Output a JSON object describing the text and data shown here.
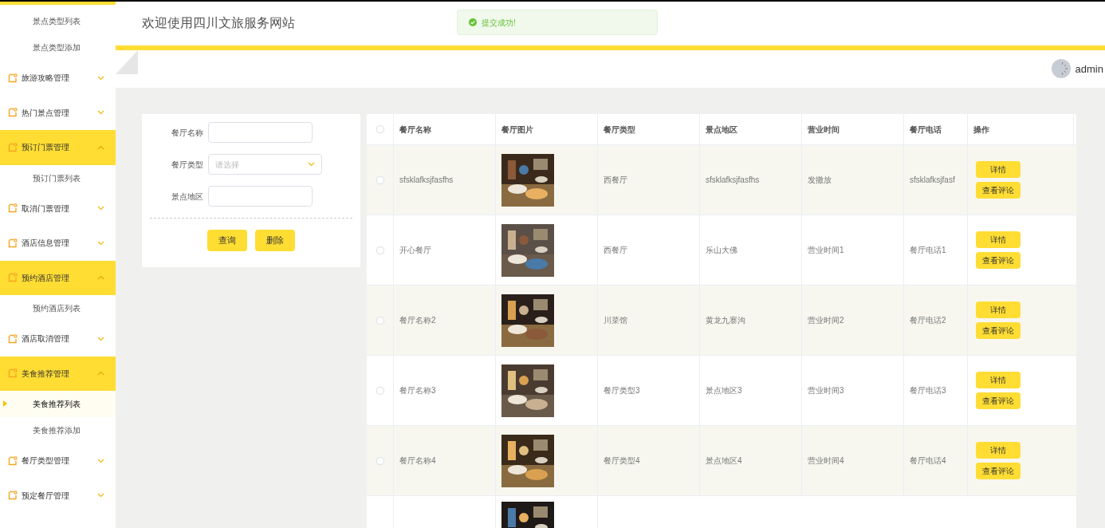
{
  "sidebar": {
    "items": [
      {
        "kind": "sub",
        "label": "景点类型列表",
        "selected": false
      },
      {
        "kind": "sub",
        "label": "景点类型添加",
        "selected": false
      },
      {
        "kind": "group",
        "label": "旅游攻略管理",
        "expanded": false
      },
      {
        "kind": "group",
        "label": "热门景点管理",
        "expanded": false
      },
      {
        "kind": "group",
        "label": "预订门票管理",
        "expanded": true
      },
      {
        "kind": "sub",
        "label": "预订门票列表",
        "selected": false
      },
      {
        "kind": "group",
        "label": "取消门票管理",
        "expanded": false
      },
      {
        "kind": "group",
        "label": "酒店信息管理",
        "expanded": false
      },
      {
        "kind": "group",
        "label": "预约酒店管理",
        "expanded": true
      },
      {
        "kind": "sub",
        "label": "预约酒店列表",
        "selected": false
      },
      {
        "kind": "group",
        "label": "酒店取消管理",
        "expanded": false
      },
      {
        "kind": "group",
        "label": "美食推荐管理",
        "expanded": true
      },
      {
        "kind": "sub",
        "label": "美食推荐列表",
        "selected": true
      },
      {
        "kind": "sub",
        "label": "美食推荐添加",
        "selected": false
      },
      {
        "kind": "group",
        "label": "餐厅类型管理",
        "expanded": false
      },
      {
        "kind": "group",
        "label": "预定餐厅管理",
        "expanded": false
      }
    ]
  },
  "header": {
    "title": "欢迎使用四川文旅服务网站",
    "user": "admin"
  },
  "toast": {
    "message": "提交成功!"
  },
  "search_form": {
    "fields": [
      {
        "kind": "input",
        "label": "餐厅名称"
      },
      {
        "kind": "select",
        "label": "餐厅类型",
        "placeholder": "请选择"
      },
      {
        "kind": "input",
        "label": "景点地区"
      }
    ],
    "buttons": [
      "查询",
      "删除"
    ]
  },
  "table": {
    "all_checked": false,
    "columns": [
      "餐厅名称",
      "餐厅图片",
      "餐厅类型",
      "景点地区",
      "营业时间",
      "餐厅电话",
      "操作"
    ],
    "rows": [
      {
        "name": "sfsklafksjfasfhs",
        "type": "西餐厅",
        "area": "sfsklafksjfasfhs",
        "hours": "发撒放",
        "phone": "sfsklafksjfasf",
        "checked": false,
        "actions": [
          "详情",
          "查看评论"
        ]
      },
      {
        "name": "开心餐厅",
        "type": "西餐厅",
        "area": "乐山大佛",
        "hours": "营业时间1",
        "phone": "餐厅电话1",
        "checked": false,
        "actions": [
          "详情",
          "查看评论"
        ]
      },
      {
        "name": "餐厅名称2",
        "type": "川菜馆",
        "area": "黄龙九寨沟",
        "hours": "营业时间2",
        "phone": "餐厅电话2",
        "checked": false,
        "actions": [
          "详情",
          "查看评论"
        ]
      },
      {
        "name": "餐厅名称3",
        "type": "餐厅类型3",
        "area": "景点地区3",
        "hours": "营业时间3",
        "phone": "餐厅电话3",
        "checked": false,
        "actions": [
          "详情",
          "查看评论"
        ]
      },
      {
        "name": "餐厅名称4",
        "type": "餐厅类型4",
        "area": "景点地区4",
        "hours": "营业时间4",
        "phone": "餐厅电话4",
        "checked": false,
        "actions": [
          "详情",
          "查看评论"
        ]
      }
    ]
  }
}
